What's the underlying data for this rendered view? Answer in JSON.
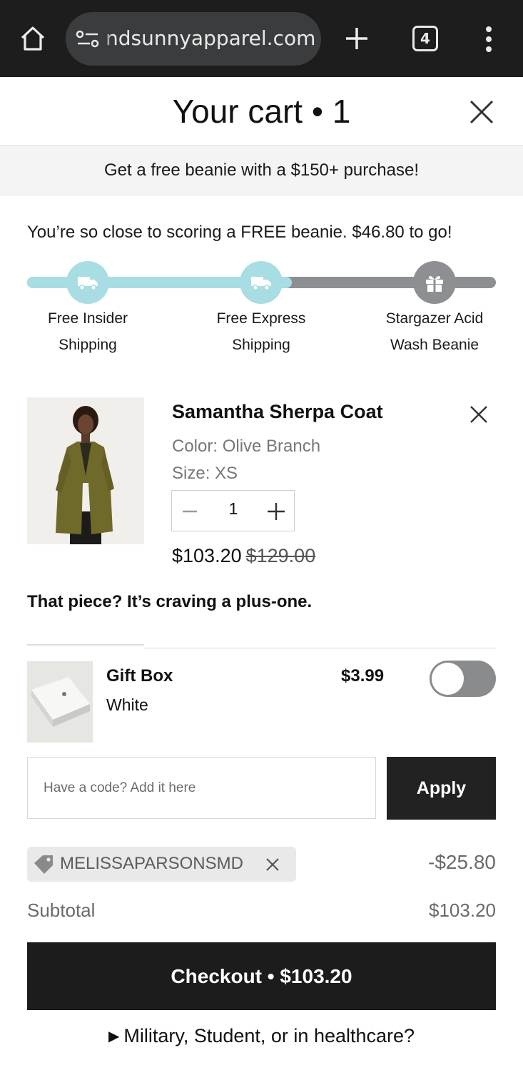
{
  "browser": {
    "url": "ndsunnyapparel.com",
    "tab_count": "4"
  },
  "cart": {
    "title": "Your cart • 1",
    "banner": "Get a free beanie with a $150+ purchase!"
  },
  "progress": {
    "message": "You’re so close to scoring a FREE beanie. $46.80 to go!",
    "fill_fraction": 0.564,
    "fill_color": "#a8dde3",
    "empty_color": "#8d8f93",
    "milestones": [
      {
        "line1": "Free Insider",
        "line2": "Shipping",
        "icon": "truck-icon",
        "reached": true
      },
      {
        "line1": "Free Express",
        "line2": "Shipping",
        "icon": "truck-icon",
        "reached": true
      },
      {
        "line1": "Stargazer Acid",
        "line2": "Wash Beanie",
        "icon": "gift-icon",
        "reached": false
      }
    ]
  },
  "item": {
    "name": "Samantha Sherpa Coat",
    "color": "Color: Olive Branch",
    "size": "Size: XS",
    "quantity": "1",
    "price": "$103.20",
    "original_price": "$129.00"
  },
  "upsell": {
    "heading": "That piece? It’s craving a plus-one."
  },
  "gift_box": {
    "name": "Gift Box",
    "variant": "White",
    "price": "$3.99",
    "enabled": false
  },
  "discount_code": {
    "placeholder": "Have a code? Add it here",
    "value": "",
    "apply_label": "Apply",
    "applied_code": "MELISSAPARSONSMD",
    "discount_amount": "-$25.80"
  },
  "summary": {
    "subtotal_label": "Subtotal",
    "subtotal_value": "$103.20",
    "checkout_label": "Checkout • $103.20",
    "disclosure_text": "Military, Student, or in healthcare?"
  },
  "colors": {
    "browser_bar": "#1d1d1d",
    "button_dark": "#1c1c1c",
    "accent_teal": "#a8dde3"
  }
}
